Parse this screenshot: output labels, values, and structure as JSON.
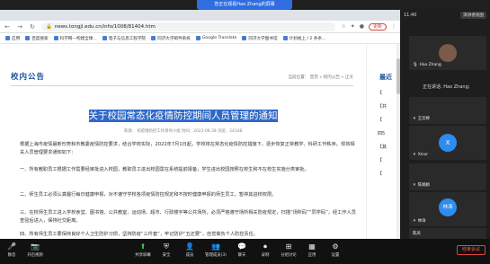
{
  "share_banner": "您正在观看Hao Zhang的屏幕",
  "browser": {
    "url": "news.tongji.edu.cn/info/1008/81404.htm",
    "update_label": "更新",
    "bookmarks": [
      "应用",
      "百度搜索",
      "科学网—构建全球...",
      "电子与信息工程学院",
      "同济大学邮件系统",
      "Google Translate",
      "同济大学图书馆",
      "计划线上 / 2 条条..."
    ]
  },
  "page": {
    "section_title": "校内公告",
    "breadcrumb": "当前位置： 首页 » 校内公告 » 正文",
    "article_title": "关于校园常态化疫情防控期间人员管理的通知",
    "meta": "来源：  校疫情防控工作领导小组    时间：2022-06-28    浏览：24148",
    "paragraphs": [
      "根据上海市疫情最新形势和市教委疫情防控要求，结合学校实际，2022年7月1日起，学校将在常态化疫情防控措施下，逐步恢复正常教学、科研工作秩序。现将相关人员管理要求通知如下：",
      "一、所有教职员工根据工作需要经审批进入校园，教职员工进出校园需在系统提前报备，学生进出校园按照在校生和不在校生实施分类审批。",
      "二、师生员工必须认真履行每日健康申报，对不遵守学校各项疫情防控规定和不按时健康申报的师生员工，暂停其进校权限。",
      "三、在校师生员工进入学校食堂、图书馆、公共教室、运动场、超市、行政楼宇等公共场所，必须严格遵守场所相关防疫规定，扫描“场所码”“同学码”，经工作人员查验后进入，保持社交距离。",
      "四、所有师生员工要保持良好个人卫生防护习惯，坚持防疫“三件套”，牢记防护“五还要”，自觉做负个人防控责任。"
    ],
    "right_col_head": "最近",
    "right_col_items": [
      "【",
      "【共",
      "【",
      "四5",
      "【其",
      "【",
      "【"
    ]
  },
  "panel": {
    "gallery_label": "演讲者视图",
    "time": "11:40",
    "participants": [
      {
        "name": "Hao Zhang",
        "avatar": "",
        "speaking": true
      },
      {
        "name": "王云婷",
        "avatar": ""
      },
      {
        "name": "Xinxr",
        "avatar": "X"
      },
      {
        "name": "陈娟娟",
        "avatar": ""
      },
      {
        "name": "林涛",
        "avatar": "林涛"
      },
      {
        "name": "陈凤",
        "avatar": ""
      }
    ],
    "speaking_label": "正在讲话: Hao Zhang;"
  },
  "toolbar": {
    "items": [
      {
        "label": "静音",
        "icon": "microphone-icon"
      },
      {
        "label": "开启视频",
        "icon": "camera-icon"
      },
      {
        "label": "共享屏幕",
        "icon": "share-screen-icon"
      },
      {
        "label": "安全",
        "icon": "shield-icon"
      },
      {
        "label": "成员",
        "icon": "members-icon"
      },
      {
        "label": "管理成员(3)",
        "icon": "manage-members-icon"
      },
      {
        "label": "聊天",
        "icon": "chat-icon"
      },
      {
        "label": "录制",
        "icon": "record-icon"
      },
      {
        "label": "分组讨论",
        "icon": "breakout-icon"
      },
      {
        "label": "应用",
        "icon": "apps-icon"
      },
      {
        "label": "设置",
        "icon": "settings-icon"
      }
    ],
    "end_label": "结束会议"
  },
  "colors": {
    "accent": "#1a4f9c",
    "highlight": "#2e68c9",
    "end": "#e0453a",
    "zoom_blue": "#2d8cf0"
  }
}
